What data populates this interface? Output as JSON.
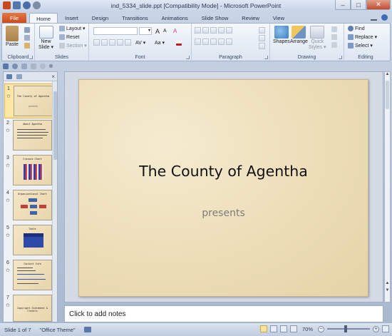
{
  "window": {
    "title": "ind_5334_slide.ppt [Compatibility Mode] - Microsoft PowerPoint",
    "minimize": "–",
    "maximize": "□",
    "close": "✕"
  },
  "tabs": [
    "File",
    "Home",
    "Insert",
    "Design",
    "Transitions",
    "Animations",
    "Slide Show",
    "Review",
    "View"
  ],
  "ribbon": {
    "clipboard": {
      "label": "Clipboard",
      "paste": "Paste"
    },
    "slides": {
      "label": "Slides",
      "new_slide": "New",
      "new_slide2": "Slide ▾",
      "layout": "Layout ▾",
      "reset": "Reset",
      "section": "Section ▾"
    },
    "font": {
      "label": "Font",
      "grow": "A",
      "shrink": "A",
      "clear": "A",
      "case": "Aa ▾",
      "spacing": "AV ▾",
      "size_arrow": "▾"
    },
    "paragraph": {
      "label": "Paragraph"
    },
    "drawing": {
      "label": "Drawing",
      "shapes": "Shapes",
      "arrange": "Arrange",
      "quick_styles": "Quick",
      "quick_styles2": "Styles ▾"
    },
    "editing": {
      "label": "Editing",
      "find": "Find",
      "replace": "Replace ▾",
      "select": "Select ▾"
    }
  },
  "slides_panel": {
    "close": "×",
    "thumbnails": [
      {
        "num": "1",
        "star": "✩",
        "title": "The County of Agentha",
        "sub": "presents"
      },
      {
        "num": "2",
        "star": "✩",
        "title": "About Agentha"
      },
      {
        "num": "3",
        "star": "✩",
        "title": "Crosses Chart"
      },
      {
        "num": "4",
        "star": "✩",
        "title": "Organizational Chart"
      },
      {
        "num": "5",
        "star": "✩",
        "title": "Table"
      },
      {
        "num": "6",
        "star": "✩",
        "title": "Contact Info"
      },
      {
        "num": "7",
        "star": "✩",
        "title": "Copyright Statement & Credits"
      }
    ]
  },
  "slide": {
    "title": "The County of Agentha",
    "subtitle": "presents"
  },
  "notes": {
    "placeholder": "Click to add notes"
  },
  "status": {
    "slide": "Slide 1 of 7",
    "theme": "\"Office Theme\"",
    "zoom": "70%",
    "zoom_out": "−",
    "zoom_in": "+"
  },
  "colors": {
    "file_tab": "#c9471a",
    "slide_bg": "#ecdcb5",
    "selected_thumb": "#fde7a5"
  }
}
